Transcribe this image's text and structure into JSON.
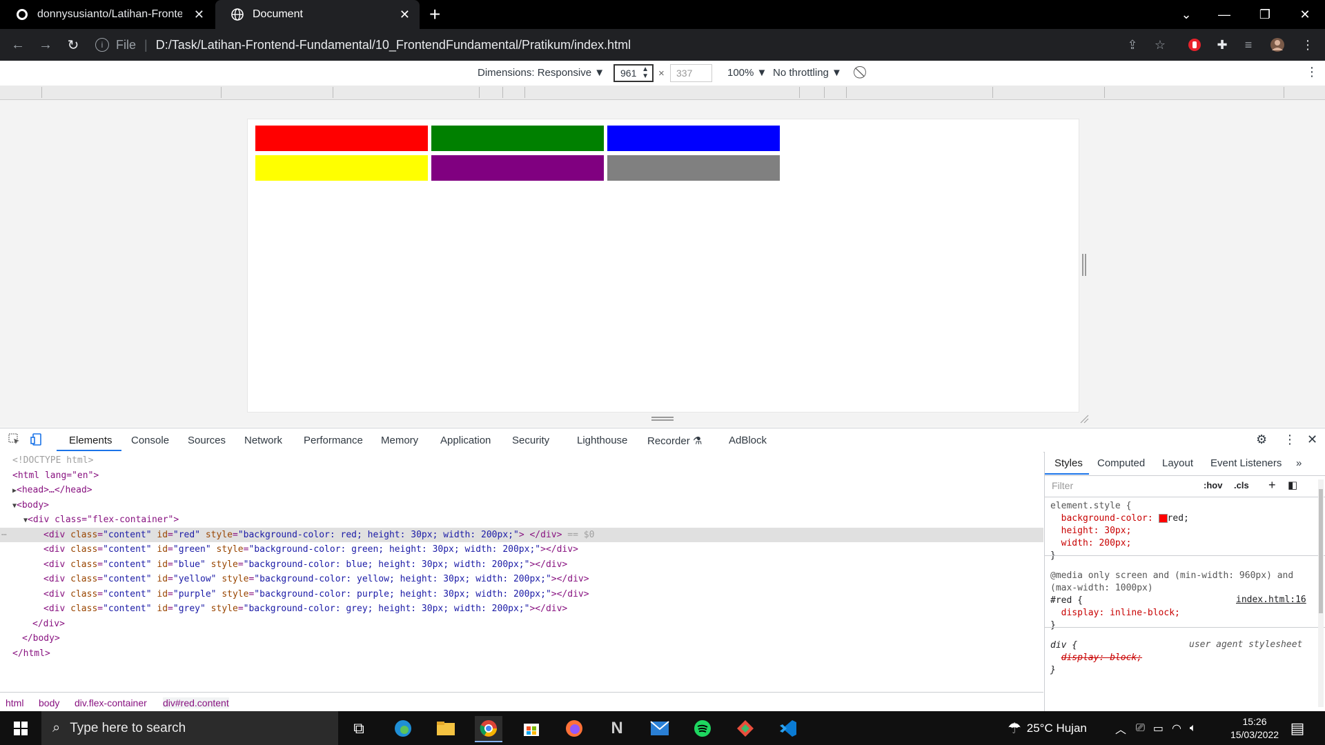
{
  "browser": {
    "tabs": [
      {
        "title": "donnysusianto/Latihan-Frontend"
      },
      {
        "title": "Document"
      }
    ],
    "url": {
      "scheme_label": "File",
      "path": "D:/Task/Latihan-Frontend-Fundamental/10_FrontendFundamental/Pratikum/index.html"
    }
  },
  "device_toolbar": {
    "dimensions_label": "Dimensions: Responsive",
    "width": "961",
    "times": "×",
    "height": "337",
    "zoom": "100%",
    "throttling": "No throttling"
  },
  "page_boxes": {
    "colors": [
      "#ff0000",
      "#008000",
      "#0000ff",
      "#ffff00",
      "#800080",
      "#808080"
    ],
    "ids": [
      "red",
      "green",
      "blue",
      "yellow",
      "purple",
      "grey"
    ]
  },
  "devtools": {
    "tabs": [
      "Elements",
      "Console",
      "Sources",
      "Network",
      "Performance",
      "Memory",
      "Application",
      "Security",
      "Lighthouse",
      "Recorder",
      "AdBlock"
    ],
    "dom": {
      "doctype": "<!DOCTYPE html>",
      "html_open": "<html lang=\"en\">",
      "head": "<head>…</head>",
      "body_open": "<body>",
      "container_open": "<div class=\"flex-container\">",
      "children": [
        {
          "id": "red",
          "style": "background-color: red; height: 30px; width: 200px;"
        },
        {
          "id": "green",
          "style": "background-color: green; height: 30px; width: 200px;"
        },
        {
          "id": "blue",
          "style": "background-color: blue; height: 30px; width: 200px;"
        },
        {
          "id": "yellow",
          "style": "background-color: yellow; height: 30px; width: 200px;"
        },
        {
          "id": "purple",
          "style": "background-color: purple; height: 30px; width: 200px;"
        },
        {
          "id": "grey",
          "style": "background-color: grey; height: 30px; width: 200px;"
        }
      ],
      "selected_suffix": "== $0",
      "container_close": "</div>",
      "body_close": "</body>",
      "html_close": "</html>"
    },
    "breadcrumb": [
      "html",
      "body",
      "div.flex-container",
      "div#red.content"
    ],
    "styles_tabs": [
      "Styles",
      "Computed",
      "Layout",
      "Event Listeners"
    ],
    "filter_placeholder": "Filter",
    "hov": ":hov",
    "cls": ".cls",
    "element_style": {
      "selector": "element.style {",
      "props": [
        "background-color: ",
        "height: 30px;",
        "width: 200px;"
      ],
      "bg_value": "red;"
    },
    "media_rule": {
      "query1": "@media only screen and (min-width: 960px) and",
      "query2": "(max-width: 1000px)",
      "selector": "#red {",
      "source": "index.html:16",
      "prop": "display: inline-block;"
    },
    "ua_rule": {
      "selector": "div {",
      "source": "user agent stylesheet",
      "prop": "display: block;"
    }
  },
  "taskbar": {
    "search_placeholder": "Type here to search",
    "weather": "25°C  Hujan",
    "time": "15:26",
    "date": "15/03/2022"
  }
}
